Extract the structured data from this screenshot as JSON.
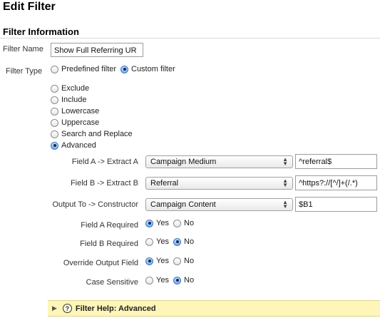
{
  "page": {
    "title": "Edit Filter"
  },
  "section": {
    "title": "Filter Information"
  },
  "filter_name": {
    "label": "Filter Name",
    "value": "Show Full Referring UR"
  },
  "filter_type": {
    "label": "Filter Type",
    "predefined": "Predefined filter",
    "custom": "Custom filter",
    "selected": "custom"
  },
  "custom_types": {
    "items": [
      "Exclude",
      "Include",
      "Lowercase",
      "Uppercase",
      "Search and Replace",
      "Advanced"
    ],
    "selected": "Advanced"
  },
  "field_a": {
    "label": "Field A -> Extract A",
    "select": "Campaign Medium",
    "value": "^referral$"
  },
  "field_b": {
    "label": "Field B -> Extract B",
    "select": "Referral",
    "value": "^https?://[^/]+(/.*)"
  },
  "output": {
    "label": "Output To -> Constructor",
    "select": "Campaign Content",
    "value": "$B1"
  },
  "options": {
    "yes": "Yes",
    "no": "No",
    "rows": [
      {
        "label": "Field A Required",
        "selected": "yes"
      },
      {
        "label": "Field B Required",
        "selected": "no"
      },
      {
        "label": "Override Output Field",
        "selected": "yes"
      },
      {
        "label": "Case Sensitive",
        "selected": "no"
      }
    ]
  },
  "help": {
    "label": "Filter Help: Advanced",
    "arrow_icon": "triangle-right",
    "help_icon": "question-circle"
  }
}
